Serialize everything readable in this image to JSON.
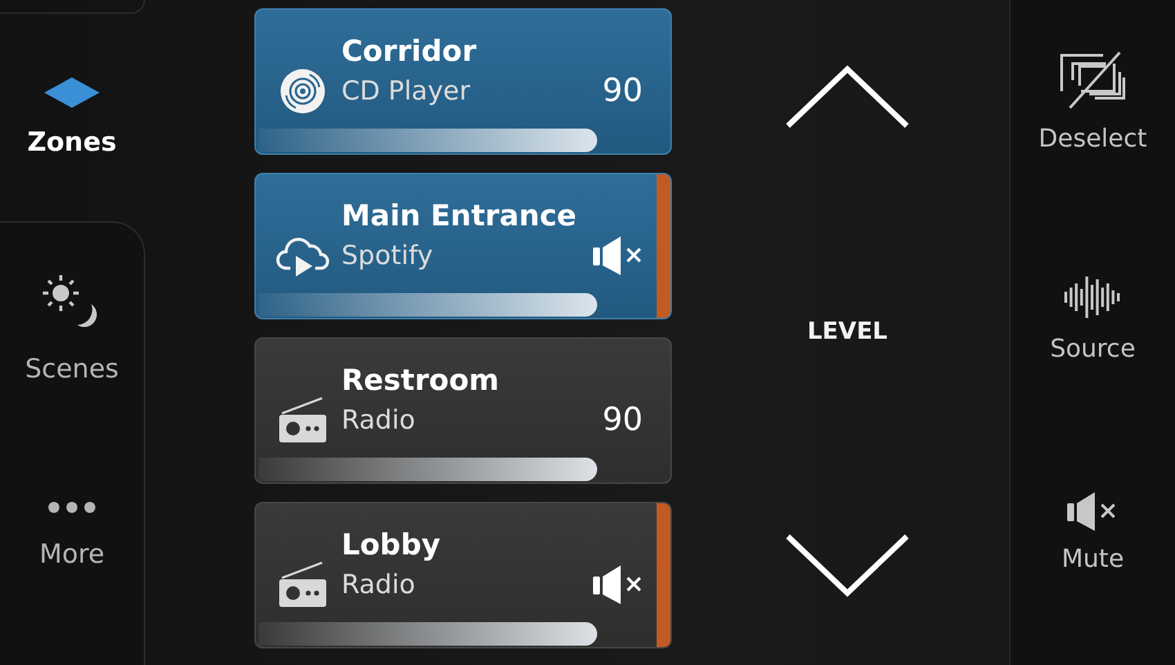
{
  "nav": {
    "items": [
      {
        "kind": "zones",
        "label": "Zones",
        "selected": true
      },
      {
        "kind": "scenes",
        "label": "Scenes",
        "selected": false
      },
      {
        "kind": "more",
        "label": "More",
        "selected": false
      }
    ]
  },
  "zones": [
    {
      "name": "Corridor",
      "source": "CD Player",
      "kind": "cd",
      "selected": true,
      "muted": false,
      "reading": "90"
    },
    {
      "name": "Main Entrance",
      "source": "Spotify",
      "kind": "streaming",
      "selected": true,
      "muted": true
    },
    {
      "name": "Restroom",
      "source": "Radio",
      "kind": "radio",
      "selected": false,
      "muted": false,
      "reading": "90"
    },
    {
      "name": "Lobby",
      "source": "Radio",
      "kind": "radio",
      "selected": false,
      "muted": true
    }
  ],
  "level_control": {
    "label": "LEVEL"
  },
  "actions": [
    {
      "kind": "deselect",
      "label": "Deselect"
    },
    {
      "kind": "source",
      "label": "Source"
    },
    {
      "kind": "mute",
      "label": "Mute"
    }
  ]
}
